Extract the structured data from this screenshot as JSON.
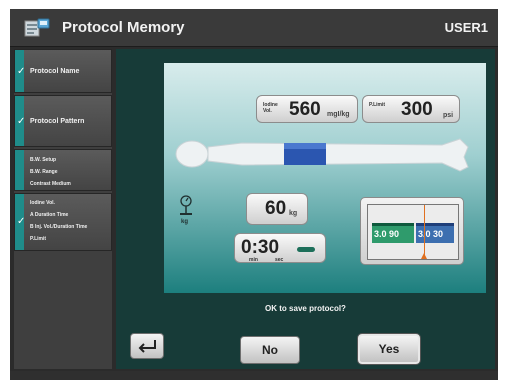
{
  "header": {
    "title": "Protocol Memory",
    "user": "USER1",
    "icon": "protocol-memory-icon"
  },
  "sidebar": {
    "protocol_name": "Protocol Name",
    "protocol_pattern": "Protocol Pattern",
    "bw_items": [
      "B.W. Setup",
      "B.W. Range",
      "Contrast Medium"
    ],
    "iodine_items": [
      "Iodine Vol.",
      "A Duration Time",
      "B Inj. Vol./Duration Time",
      "P.Limit"
    ],
    "accent_color": "#1f8c8a"
  },
  "panel": {
    "iodine": {
      "label_line1": "Iodine",
      "label_line2": "Vol.",
      "value": "560",
      "unit": "mgI/kg"
    },
    "plimit": {
      "label": "P.Limit",
      "value": "300",
      "unit": "psi"
    },
    "weight": {
      "value": "60",
      "unit": "kg",
      "icon_label": "kg"
    },
    "time": {
      "value": "0:30",
      "min_label": "min",
      "sec_label": "sec"
    },
    "phase_a": "3.0 90",
    "phase_b": "3.0 30",
    "phase_a_color": "#2f9b6c",
    "phase_b_color": "#3d6fb0"
  },
  "dialog": {
    "question": "OK to save protocol?",
    "no_label": "No",
    "yes_label": "Yes",
    "back_icon": "return-arrow-icon"
  }
}
